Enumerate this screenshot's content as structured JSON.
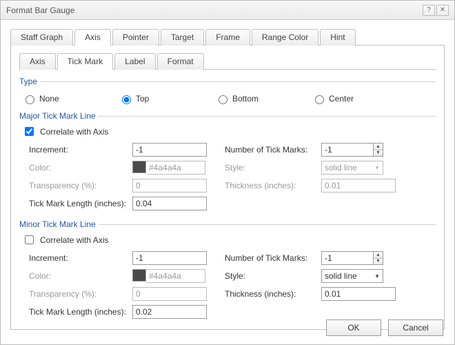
{
  "window": {
    "title": "Format Bar Gauge"
  },
  "outerTabs": {
    "staff": "Staff Graph",
    "axis": "Axis",
    "pointer": "Pointer",
    "target": "Target",
    "frame": "Frame",
    "range": "Range Color",
    "hint": "Hint"
  },
  "innerTabs": {
    "axis": "Axis",
    "tick": "Tick Mark",
    "label": "Label",
    "format": "Format"
  },
  "sections": {
    "type": "Type",
    "major": "Major Tick Mark Line",
    "minor": "Minor Tick Mark Line"
  },
  "type": {
    "none": "None",
    "top": "Top",
    "bottom": "Bottom",
    "center": "Center"
  },
  "labels": {
    "correlate": "Correlate with Axis",
    "increment": "Increment:",
    "color": "Color:",
    "transparency": "Transparency (%):",
    "ticklength": "Tick Mark Length (inches):",
    "numticks": "Number of Tick Marks:",
    "style": "Style:",
    "thickness": "Thickness (inches):"
  },
  "major": {
    "correlate": true,
    "increment": "-1",
    "colorHex": "#4a4a4a",
    "transparency": "0",
    "ticklength": "0.04",
    "numticks": "-1",
    "style": "solid line",
    "thickness": "0.01"
  },
  "minor": {
    "correlate": false,
    "increment": "-1",
    "colorHex": "#4a4a4a",
    "transparency": "0",
    "ticklength": "0.02",
    "numticks": "-1",
    "style": "solid line",
    "thickness": "0.01"
  },
  "buttons": {
    "ok": "OK",
    "cancel": "Cancel"
  }
}
